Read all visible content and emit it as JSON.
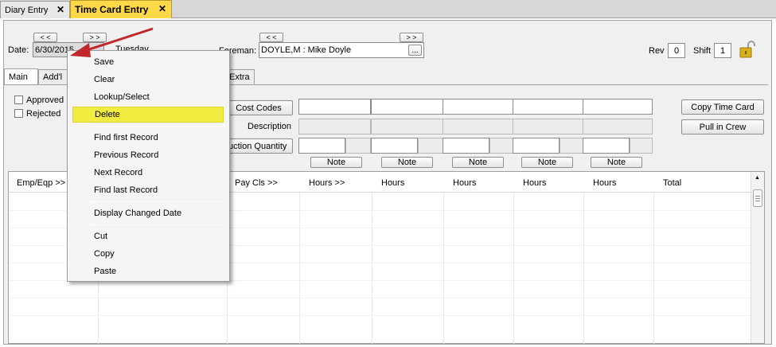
{
  "tabs": [
    {
      "label": "Diary Entry",
      "close": "✕"
    },
    {
      "label": "Time Card Entry",
      "close": "✕"
    }
  ],
  "header": {
    "date_label": "Date:",
    "date_value": "6/30/2015",
    "weekday": "Tuesday",
    "prev_label": "< <",
    "next_label": "> >",
    "foreman_label": "Foreman:",
    "foreman_value": "DOYLE,M : Mike Doyle",
    "foreman_lookup": "...",
    "rev_label": "Rev",
    "rev_value": "0",
    "shift_label": "Shift",
    "shift_value": "1"
  },
  "inner_tabs": [
    "Main",
    "Add'l",
    "Extra"
  ],
  "checkboxes": {
    "approved": "Approved",
    "rejected": "Rejected"
  },
  "cost_section": {
    "cost_codes_button": "Cost Codes",
    "description_label": "Description",
    "quantity_button": "uction Quantity",
    "note_label": "Note"
  },
  "actions": {
    "copy_time_card": "Copy Time Card",
    "pull_in_crew": "Pull in Crew"
  },
  "grid": {
    "columns": [
      "Emp/Eqp >>",
      "Pay Cls >>",
      "Hours >>",
      "Hours",
      "Hours",
      "Hours",
      "Hours",
      "Total"
    ]
  },
  "context_menu": {
    "items": [
      "Save",
      "Clear",
      "Lookup/Select",
      "Delete",
      "Find first Record",
      "Previous Record",
      "Next Record",
      "Find last Record",
      "Display Changed Date",
      "Cut",
      "Copy",
      "Paste"
    ],
    "highlighted": "Delete"
  },
  "colors": {
    "active_tab": "#ffd84a",
    "menu_highlight": "#f3ec40",
    "arrow": "#c0282a",
    "lock": "#d8b020"
  }
}
